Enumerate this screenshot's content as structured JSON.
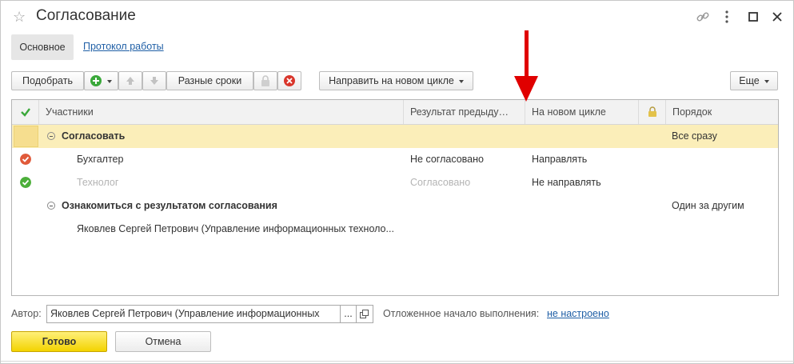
{
  "window": {
    "title": "Согласование"
  },
  "tabs": {
    "main": "Основное",
    "log": "Протокол работы"
  },
  "toolbar": {
    "pick": "Подобрать",
    "terms": "Разные сроки",
    "new_cycle": "Направить на новом цикле",
    "more": "Еще"
  },
  "table": {
    "headers": {
      "participants": "Участники",
      "prev_result": "Результат предыду…",
      "new_cycle": "На новом цикле",
      "order": "Порядок"
    },
    "rows": [
      {
        "name": "Согласовать",
        "result": "",
        "cycle": "",
        "order": "Все сразу"
      },
      {
        "name": "Бухгалтер",
        "result": "Не согласовано",
        "cycle": "Направлять",
        "order": ""
      },
      {
        "name": "Технолог",
        "result": "Согласовано",
        "cycle": "Не направлять",
        "order": ""
      },
      {
        "name": "Ознакомиться с результатом согласования",
        "result": "",
        "cycle": "",
        "order": "Один за другим"
      },
      {
        "name": "Яковлев Сергей Петрович (Управление информационных техноло...",
        "result": "",
        "cycle": "",
        "order": ""
      }
    ]
  },
  "footer": {
    "author_label": "Автор:",
    "author_value": "Яковлев Сергей Петрович (Управление информационных",
    "author_dots": "...",
    "delay_label": "Отложенное начало выполнения:",
    "delay_value": "не настроено",
    "ok": "Готово",
    "cancel": "Отмена"
  },
  "colors": {
    "accent_yellow": "#f3d300",
    "row_highlight": "#fbeeb9",
    "link": "#1f5fa6",
    "annotation": "#e00000"
  }
}
